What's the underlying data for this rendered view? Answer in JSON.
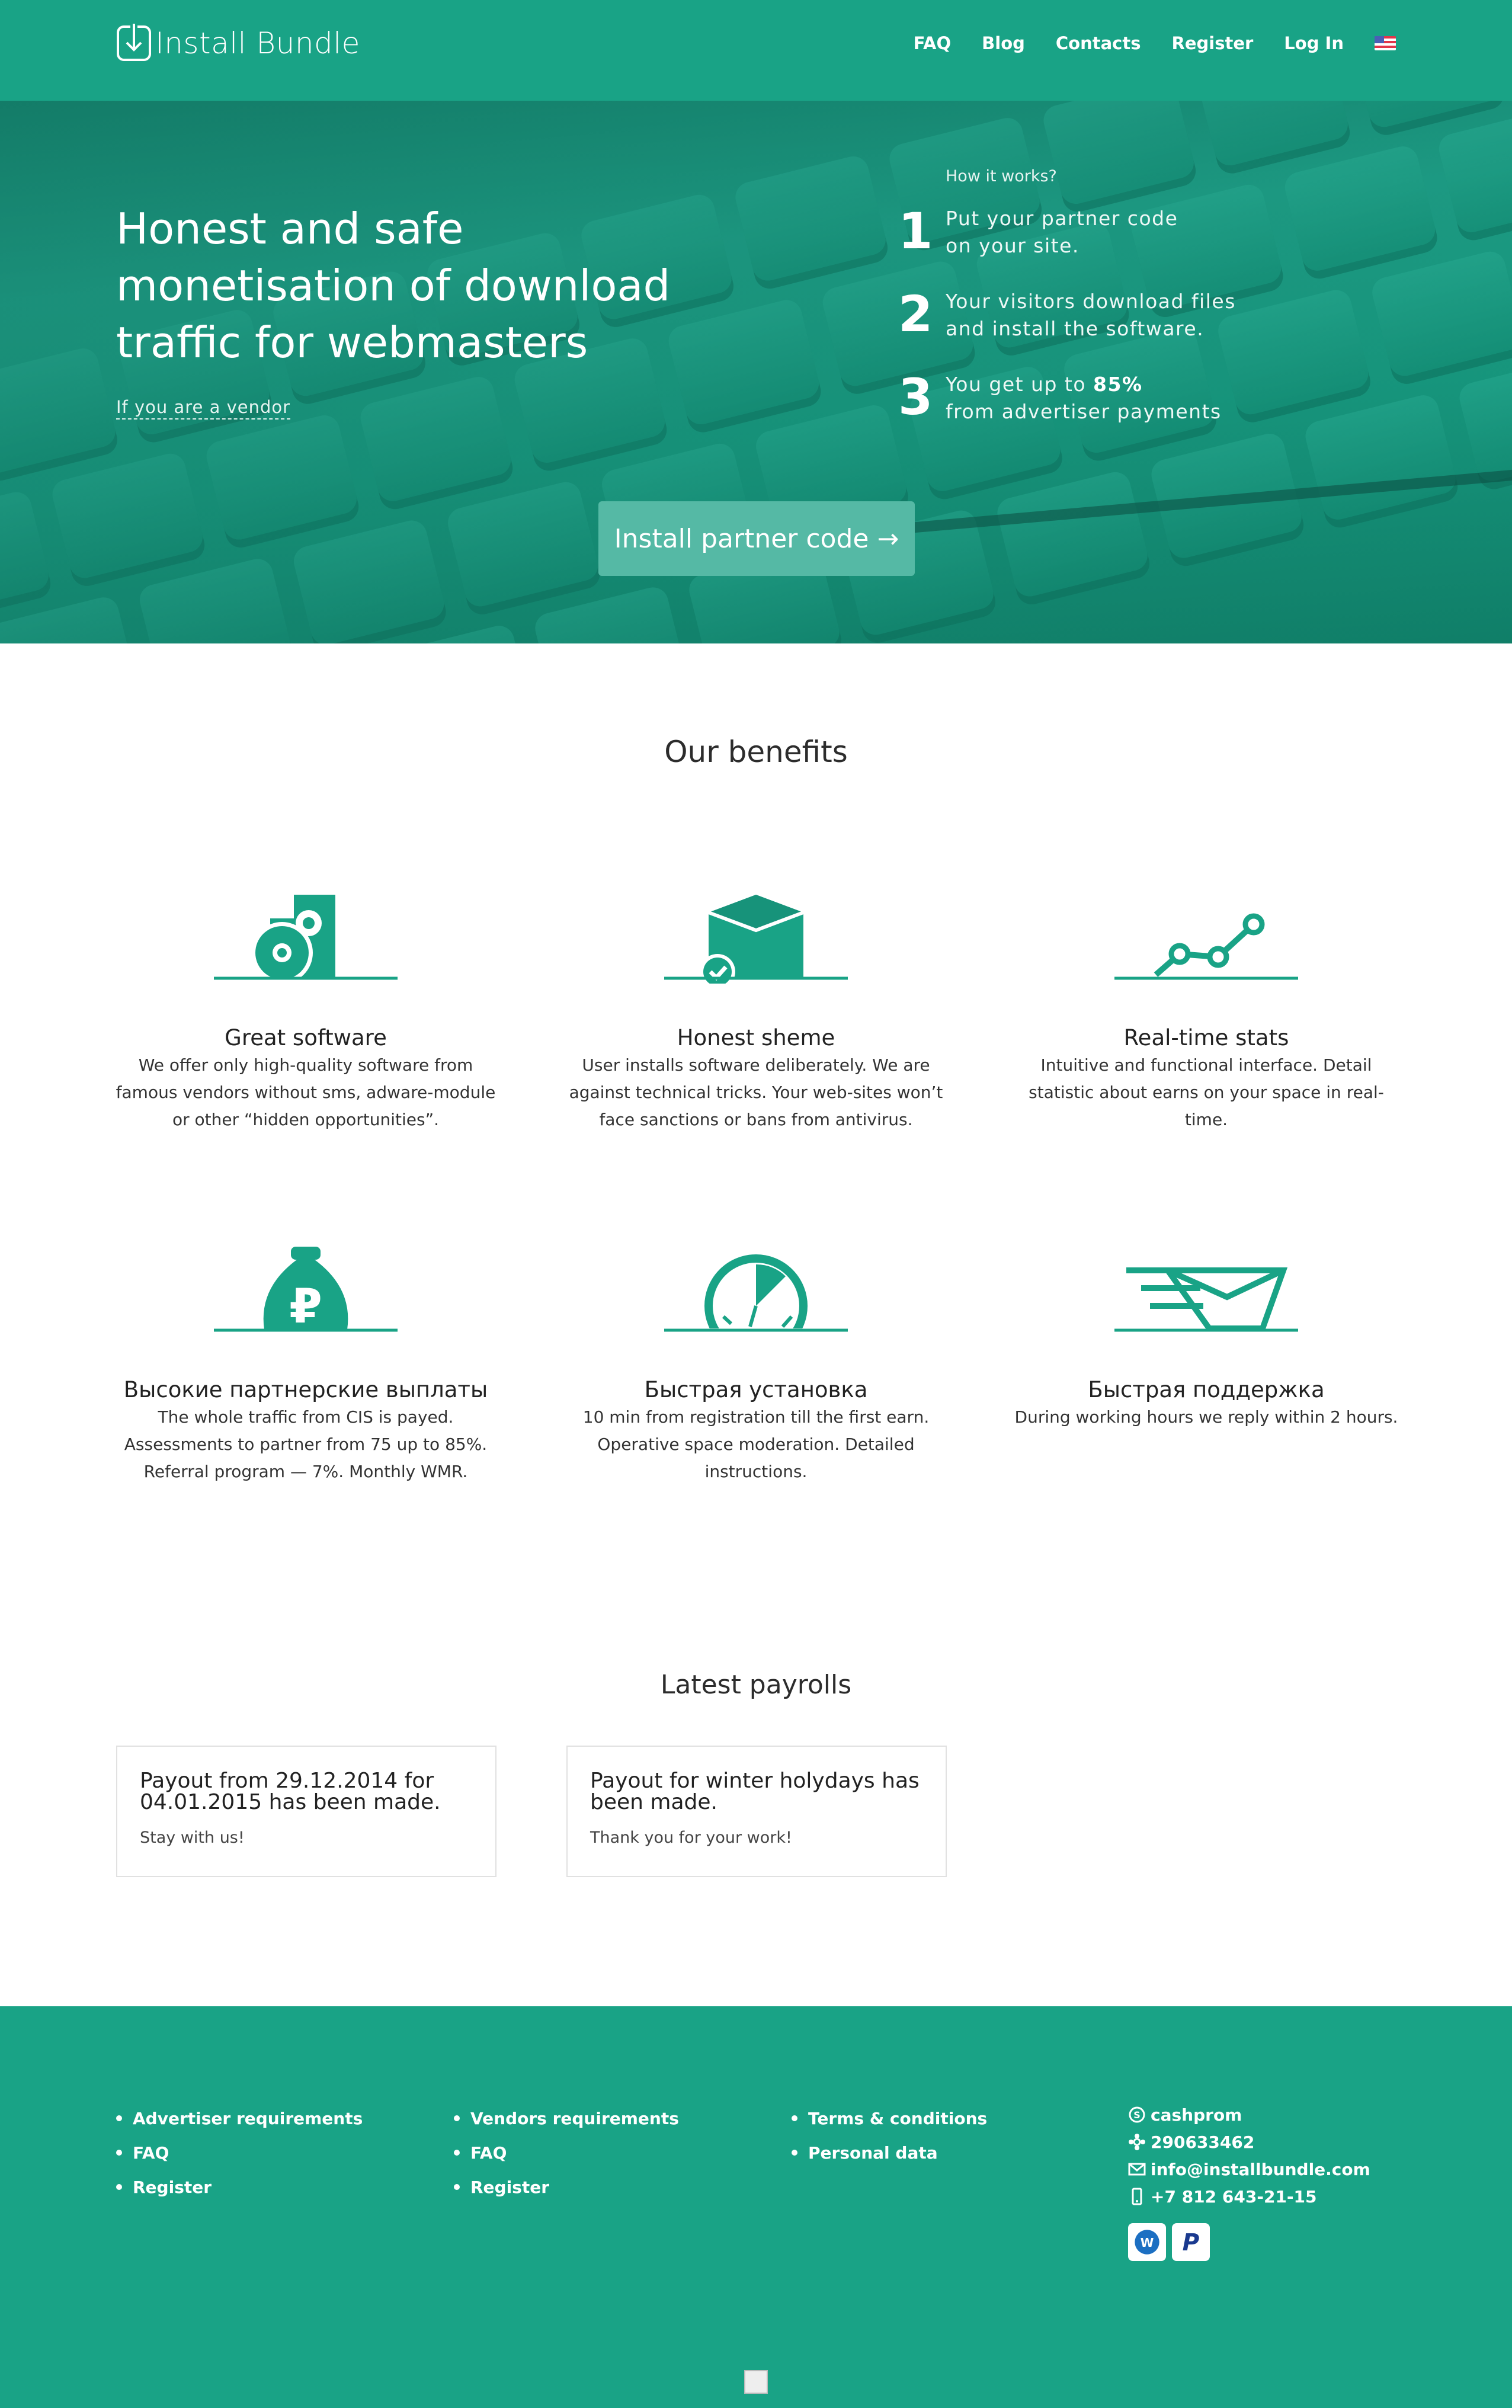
{
  "header": {
    "logo_text": "Install Bundle",
    "nav": [
      "FAQ",
      "Blog",
      "Contacts",
      "Register",
      "Log In"
    ],
    "language_flag": "us-flag-icon"
  },
  "hero": {
    "title": "Honest and safe monetisation of download traffic for webmasters",
    "vendor_link": "If you are a vendor",
    "how_title": "How it works?",
    "steps": [
      {
        "num": "1",
        "text_line1": "Put your partner code",
        "text_line2": "on your site."
      },
      {
        "num": "2",
        "text_line1": "Your visitors download files",
        "text_line2": "and install the software."
      },
      {
        "num": "3",
        "text_line1_pre": "You get up to ",
        "text_line1_bold": "85%",
        "text_line2": "from advertiser payments"
      }
    ],
    "cta": "Install partner code →"
  },
  "benefits": {
    "title": "Our benefits",
    "items": [
      {
        "title": "Great software",
        "text": "We offer only high-quality software from famous vendors without sms, adware-module or other “hidden opportunities”.",
        "icon": "software-disc-icon"
      },
      {
        "title": "Honest sheme",
        "text": "User installs software deliberately. We are against technical tricks. Your web-sites won’t face sanctions or bans from antivirus.",
        "icon": "box-check-icon"
      },
      {
        "title": "Real-time stats",
        "text": "Intuitive and functional interface. Detail statistic about earns on your space in real-time.",
        "icon": "stats-line-icon"
      },
      {
        "title": "Высокие партнерские выплаты",
        "text": "The whole traffic from CIS is payed. Assessments to partner from 75 up to 85%. Referral program — 7%. Monthly WMR.",
        "icon": "ruble-bag-icon"
      },
      {
        "title": "Быстрая установка",
        "text": "10 min from registration till the first earn. Operative space moderation. Detailed instructions.",
        "icon": "stopwatch-icon"
      },
      {
        "title": "Быстрая поддержка",
        "text": "During working hours we reply within 2 hours.",
        "icon": "fast-mail-icon"
      }
    ]
  },
  "payrolls": {
    "title": "Latest payrolls",
    "items": [
      {
        "title": "Payout from 29.12.2014 for 04.01.2015 has been made.",
        "text": "Stay with us!"
      },
      {
        "title": "Payout for winter holydays has been made.",
        "text": "Thank you for your work!"
      }
    ]
  },
  "footer": {
    "col1": [
      "Advertiser requirements",
      "FAQ",
      "Register"
    ],
    "col2": [
      "Vendors requirements",
      "FAQ",
      "Register"
    ],
    "col3": [
      "Terms & conditions",
      "Personal data"
    ],
    "contacts": {
      "skype": "cashprom",
      "icq": "290633462",
      "email": "info@installbundle.com",
      "phone": "+7 812 643-21-15"
    },
    "payment_icons": [
      "webmoney-icon",
      "paypal-icon"
    ],
    "colors": {
      "teal": "#19a386"
    }
  }
}
